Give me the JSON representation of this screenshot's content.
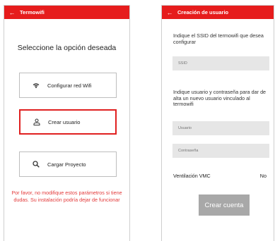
{
  "left_screen": {
    "appbar": {
      "title": "Termowifi",
      "back_icon": "arrow-left-icon"
    },
    "heading": "Seleccione la opción deseada",
    "options": [
      {
        "label": "Configurar red Wifi",
        "icon": "wifi-icon"
      },
      {
        "label": "Crear usuario",
        "icon": "user-icon",
        "selected": true
      },
      {
        "label": "Cargar Proyecto",
        "icon": "search-icon"
      }
    ],
    "warning": "Por favor, no modifique estos parámetros si tiene dudas. Su instalación podría dejar de funcionar",
    "colors": {
      "accent": "#e61c1c",
      "selected_border": "#e02020",
      "warning_text": "#e33a3a"
    }
  },
  "right_screen": {
    "appbar": {
      "title": "Creación de usuario",
      "back_icon": "arrow-left-icon"
    },
    "ssid_label": "Indique el SSID del termowifi que desea configurar",
    "ssid_placeholder": "SSID",
    "user_label": "Indique usuario y contraseña para dar de alta un nuevo usuario vinculado al termowifi",
    "user_placeholder": "Usuario",
    "password_placeholder": "Contraseña",
    "vmc_label": "Ventilación VMC",
    "vmc_value": "No",
    "create_button": "Crear cuenta",
    "colors": {
      "field_bg": "#e6e6e6",
      "button_bg": "#a8a8a8"
    }
  }
}
